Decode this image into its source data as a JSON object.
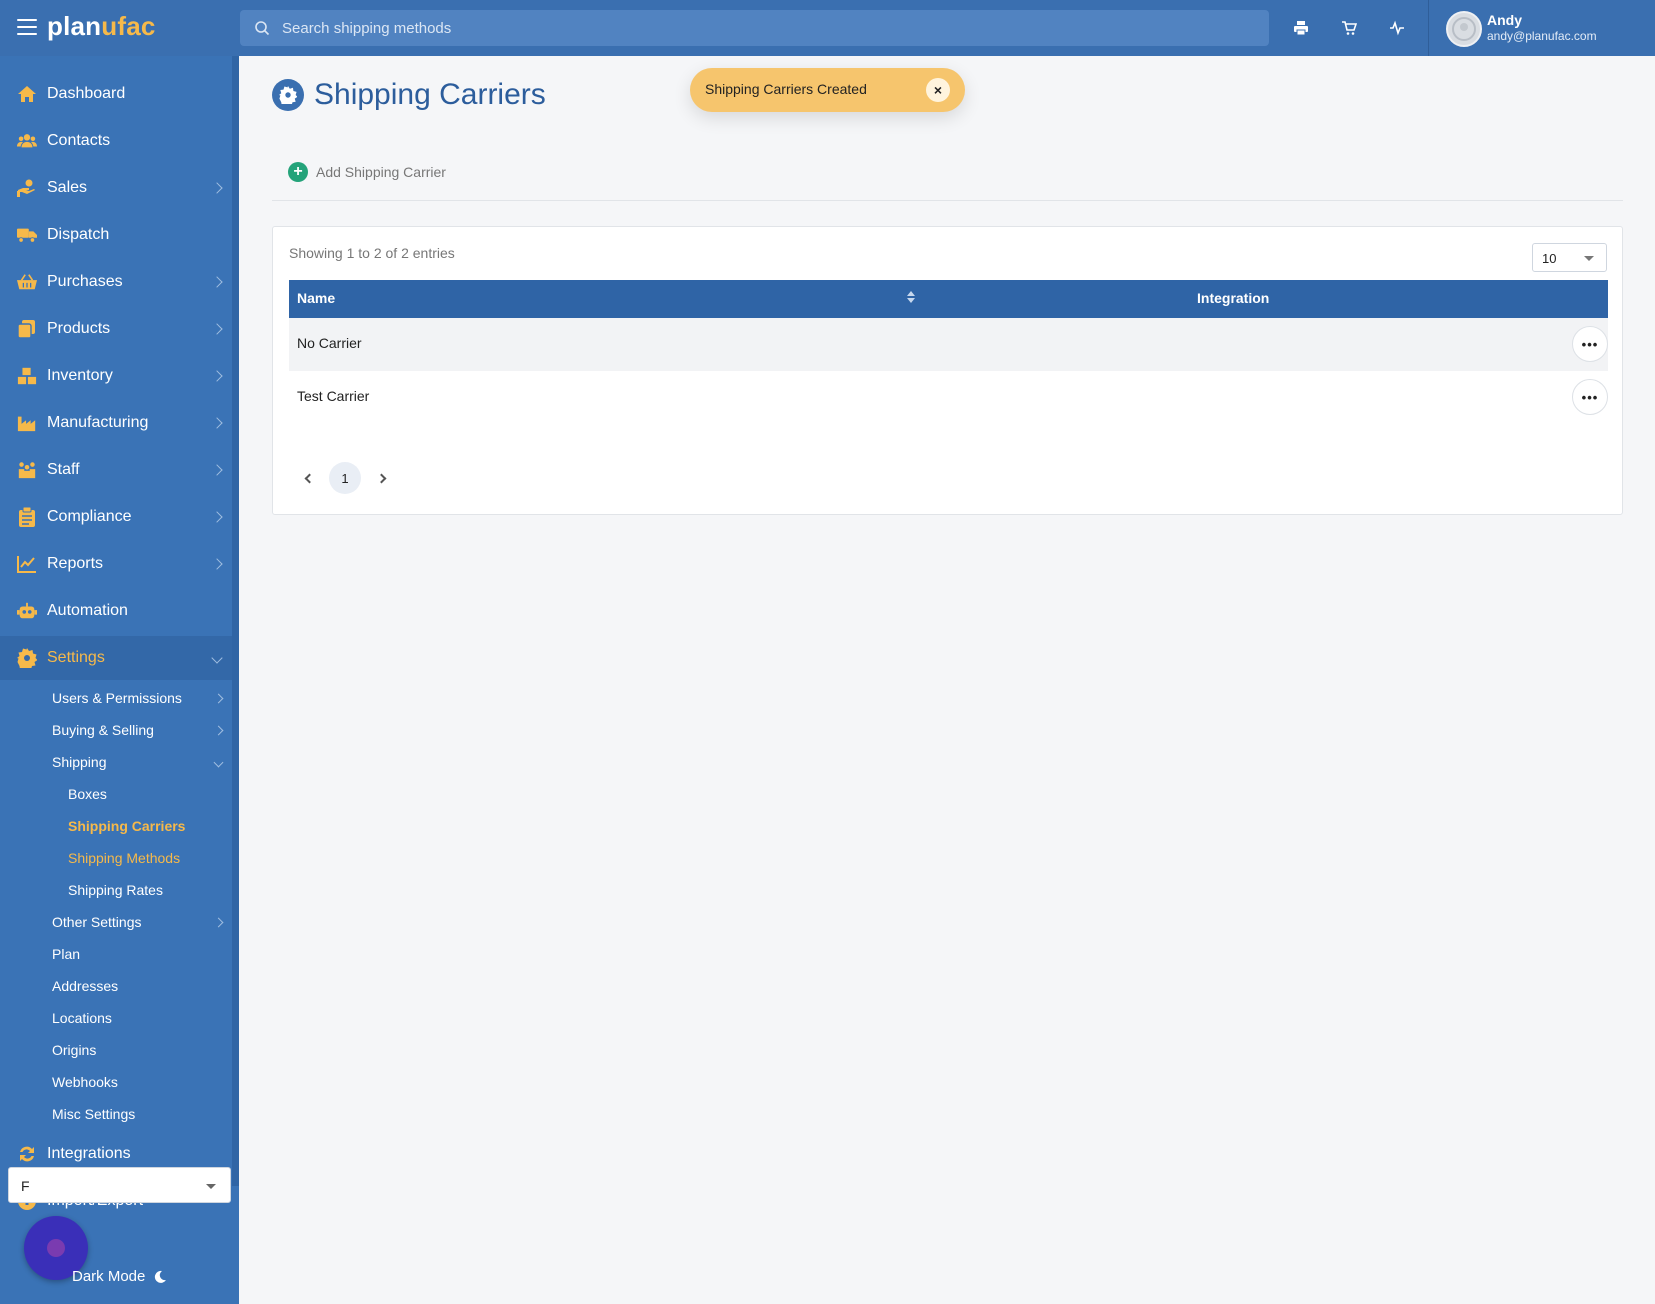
{
  "app": {
    "logo_part1": "plan",
    "logo_part2": "ufac"
  },
  "search": {
    "placeholder": "Search shipping methods",
    "value": ""
  },
  "topbar_icons": [
    "printer-icon",
    "cart-icon",
    "activity-icon"
  ],
  "user": {
    "name": "Andy",
    "email": "andy@planufac.com"
  },
  "sidebar": {
    "items": [
      {
        "label": "Dashboard",
        "icon": "home-icon",
        "has_children": false
      },
      {
        "label": "Contacts",
        "icon": "users-icon",
        "has_children": false
      },
      {
        "label": "Sales",
        "icon": "hand-money-icon",
        "has_children": true
      },
      {
        "label": "Dispatch",
        "icon": "truck-icon",
        "has_children": false
      },
      {
        "label": "Purchases",
        "icon": "basket-icon",
        "has_children": true
      },
      {
        "label": "Products",
        "icon": "copy-icon",
        "has_children": true
      },
      {
        "label": "Inventory",
        "icon": "boxes-icon",
        "has_children": true
      },
      {
        "label": "Manufacturing",
        "icon": "factory-icon",
        "has_children": true
      },
      {
        "label": "Staff",
        "icon": "people-icon",
        "has_children": true
      },
      {
        "label": "Compliance",
        "icon": "clipboard-icon",
        "has_children": true
      },
      {
        "label": "Reports",
        "icon": "chart-line-icon",
        "has_children": true
      },
      {
        "label": "Automation",
        "icon": "robot-icon",
        "has_children": false
      },
      {
        "label": "Settings",
        "icon": "gear-icon",
        "has_children": true,
        "expanded": true
      }
    ],
    "settings_children": [
      {
        "label": "Users & Permissions",
        "has_children": true
      },
      {
        "label": "Buying & Selling",
        "has_children": true
      },
      {
        "label": "Shipping",
        "has_children": true,
        "expanded": true
      }
    ],
    "shipping_children": [
      {
        "label": "Boxes"
      },
      {
        "label": "Shipping Carriers",
        "active": true
      },
      {
        "label": "Shipping Methods",
        "highlighted": true
      },
      {
        "label": "Shipping Rates"
      }
    ],
    "settings_children_after": [
      {
        "label": "Other Settings",
        "has_children": true
      },
      {
        "label": "Plan"
      },
      {
        "label": "Addresses"
      },
      {
        "label": "Locations"
      },
      {
        "label": "Origins"
      },
      {
        "label": "Webhooks"
      },
      {
        "label": "Misc Settings"
      }
    ],
    "bottom_items": [
      {
        "label": "Integrations",
        "icon": "sync-icon"
      },
      {
        "label": "Import/Export",
        "icon": "upload-circle-icon"
      }
    ],
    "select_value": "F",
    "dark_mode_label": "Dark Mode"
  },
  "page": {
    "title": "Shipping Carriers",
    "add_label": "Add Shipping Carrier"
  },
  "toast": {
    "message": "Shipping Carriers Created",
    "close_symbol": "×"
  },
  "table": {
    "showing": "Showing 1 to 2 of 2 entries",
    "page_size": "10",
    "columns": [
      "Name",
      "Integration"
    ],
    "rows": [
      {
        "name": "No Carrier",
        "integration": ""
      },
      {
        "name": "Test Carrier",
        "integration": ""
      }
    ],
    "row_menu_symbol": "•••",
    "current_page": "1"
  },
  "colors": {
    "primary": "#3a6fb0",
    "sidebar": "#3a73b6",
    "accent": "#f6b94a",
    "toast": "#f6c56d",
    "add_green": "#24a37a"
  }
}
